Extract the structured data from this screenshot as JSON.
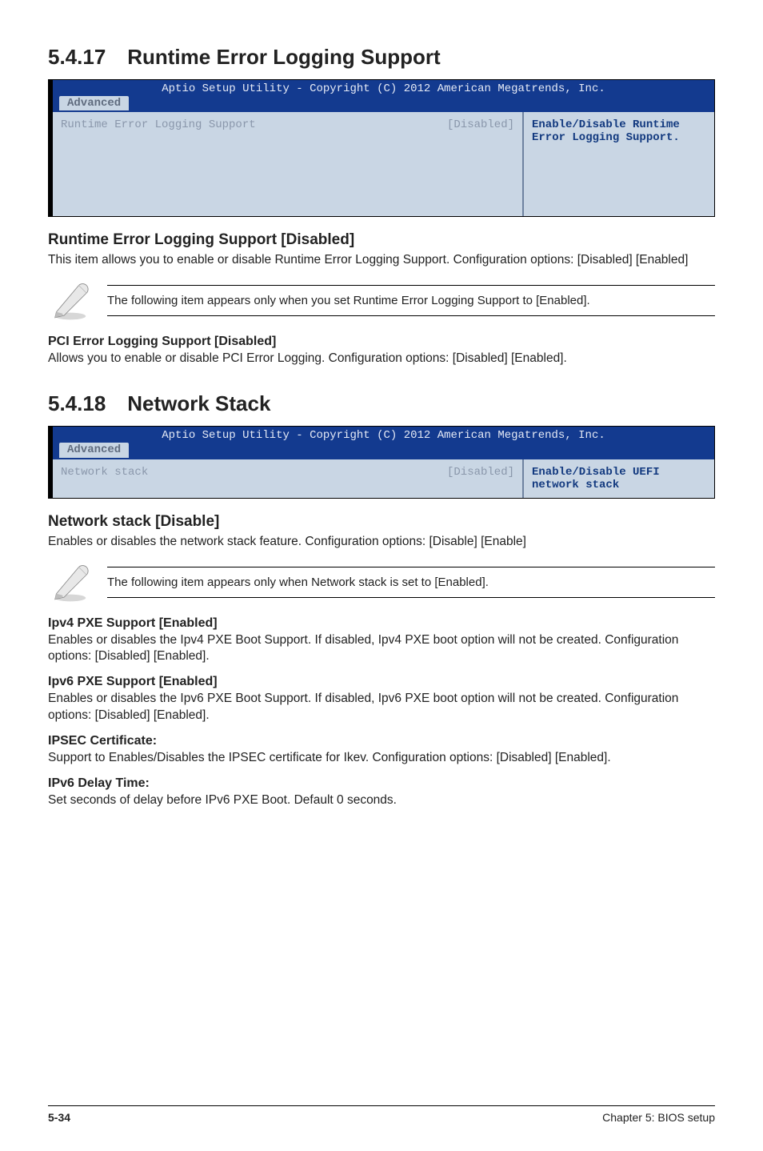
{
  "section1": {
    "number": "5.4.17",
    "title": "Runtime Error Logging Support",
    "bios": {
      "copyright": "Aptio Setup Utility - Copyright (C) 2012 American Megatrends, Inc.",
      "tab": "Advanced",
      "left_label": "Runtime Error Logging Support",
      "left_value": "[Disabled]",
      "right_help": "Enable/Disable Runtime Error Logging Support."
    },
    "h3": "Runtime Error Logging Support [Disabled]",
    "p1": "This item allows you to enable or disable Runtime Error Logging Support. Configuration options: [Disabled] [Enabled]",
    "note": "The following item appears only when you set Runtime Error Logging Support to [Enabled].",
    "h4": "PCI Error Logging Support [Disabled]",
    "p2": "Allows you to enable or disable PCI Error Logging. Configuration options: [Disabled] [Enabled]."
  },
  "section2": {
    "number": "5.4.18",
    "title": "Network Stack",
    "bios": {
      "copyright": "Aptio Setup Utility - Copyright (C) 2012 American Megatrends, Inc.",
      "tab": "Advanced",
      "left_label": "Network stack",
      "left_value": "[Disabled]",
      "right_help": "Enable/Disable UEFI network stack"
    },
    "h3": "Network stack [Disable]",
    "p1": "Enables or disables the network stack feature. Configuration options: [Disable] [Enable]",
    "note": "The following item appears only when Network stack is set to [Enabled].",
    "items": {
      "ipv4_h": "Ipv4 PXE Support [Enabled]",
      "ipv4_p": "Enables or disables the Ipv4 PXE Boot Support. If disabled, Ipv4 PXE boot option will not be created. Configuration options: [Disabled] [Enabled].",
      "ipv6_h": "Ipv6 PXE Support [Enabled]",
      "ipv6_p": "Enables or disables the Ipv6 PXE Boot Support. If disabled, Ipv6 PXE boot option will not be created. Configuration options: [Disabled] [Enabled].",
      "ipsec_h": "IPSEC Certificate:",
      "ipsec_p": "Support to Enables/Disables the IPSEC certificate for Ikev. Configuration options: [Disabled] [Enabled].",
      "delay_h": "IPv6 Delay Time:",
      "delay_p": "Set seconds of delay before IPv6 PXE Boot. Default 0 seconds."
    }
  },
  "footer": {
    "page": "5-34",
    "chapter": "Chapter 5: BIOS setup"
  }
}
